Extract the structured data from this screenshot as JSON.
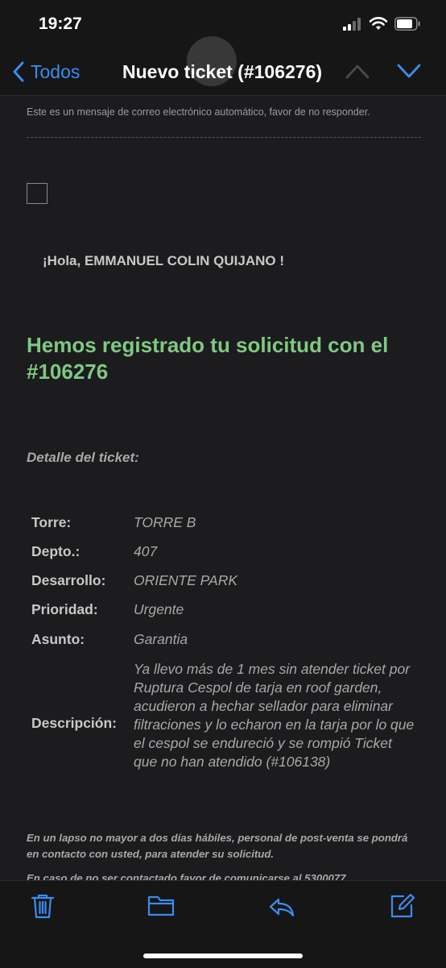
{
  "status_bar": {
    "time": "19:27"
  },
  "nav": {
    "back_label": "Todos",
    "title": "Nuevo ticket (#106276)"
  },
  "email": {
    "auto_message": "Este es un mensaje de correo electrónico automático, favor de no responder.",
    "greeting": "¡Hola, EMMANUEL COLIN QUIJANO !",
    "headline": "Hemos registrado tu solicitud con el #106276",
    "detail_title": "Detalle del ticket:",
    "details": [
      {
        "label": "Torre:",
        "value": "TORRE B"
      },
      {
        "label": "Depto.:",
        "value": "407"
      },
      {
        "label": "Desarrollo:",
        "value": "ORIENTE PARK"
      },
      {
        "label": "Prioridad:",
        "value": "Urgente"
      },
      {
        "label": "Asunto:",
        "value": "Garantia"
      },
      {
        "label": "Descripción:",
        "value": "Ya llevo más de 1 mes sin atender ticket por Ruptura Cespol de tarja en roof garden, acudieron a hechar sellador para eliminar filtraciones y lo echaron en la tarja por lo que el cespol se endureció y se rompió Ticket que no han atendido (#106138)"
      }
    ],
    "footer_note": "En un lapso no mayor a dos días hábiles, personal de post-venta se pondrá en contacto con usted, para atender su solicitud.",
    "partial_line": "En caso de no ser contactado favor de comunicarse al 5300077"
  },
  "colors": {
    "accent": "#3b8cf2",
    "headline": "#7ec982",
    "background": "#1c1c1e"
  },
  "icons": [
    "back-chevron-icon",
    "chevron-up-icon",
    "chevron-down-icon",
    "trash-icon",
    "folder-icon",
    "reply-icon",
    "compose-icon"
  ]
}
